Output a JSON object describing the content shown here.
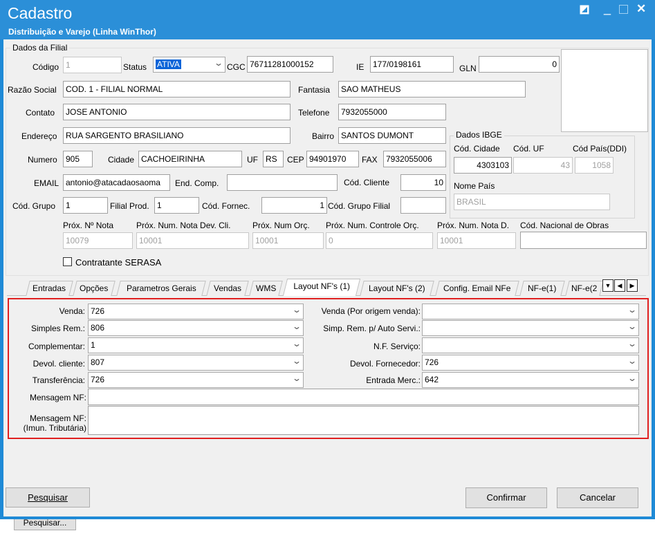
{
  "window": {
    "title": "Cadastro",
    "subtitle": "Distribuição e Varejo (Linha WinThor)",
    "bg_color": "#2b8fd8"
  },
  "icons": {
    "restore": "restore-icon",
    "minimize": "minimize-icon",
    "maximize": "maximize-icon",
    "close": "close-icon"
  },
  "filial": {
    "group_title": "Dados da Filial",
    "codigo": {
      "label": "Código",
      "value": "1"
    },
    "status": {
      "label": "Status",
      "value": "ATIVA"
    },
    "cgc": {
      "label": "CGC",
      "value": "76711281000152"
    },
    "ie": {
      "label": "IE",
      "value": "177/0198161"
    },
    "gln": {
      "label": "GLN",
      "value": "0"
    },
    "razao_social": {
      "label": "Razão Social",
      "value": "COD. 1 - FILIAL NORMAL"
    },
    "fantasia": {
      "label": "Fantasia",
      "value": "SAO MATHEUS"
    },
    "contato": {
      "label": "Contato",
      "value": "JOSE ANTONIO"
    },
    "telefone": {
      "label": "Telefone",
      "value": "7932055000"
    },
    "endereco": {
      "label": "Endereço",
      "value": "RUA SARGENTO BRASILIANO"
    },
    "bairro": {
      "label": "Bairro",
      "value": "SANTOS DUMONT"
    },
    "numero": {
      "label": "Numero",
      "value": "905"
    },
    "cidade": {
      "label": "Cidade",
      "value": "CACHOEIRINHA"
    },
    "uf": {
      "label": "UF",
      "value": "RS"
    },
    "cep": {
      "label": "CEP",
      "value": "94901970"
    },
    "fax": {
      "label": "FAX",
      "value": "7932055006"
    },
    "email": {
      "label": "EMAIL",
      "value": "antonio@atacadaosaoma"
    },
    "end_comp": {
      "label": "End. Comp.",
      "value": ""
    },
    "cod_cliente": {
      "label": "Cód. Cliente",
      "value": "10"
    },
    "cod_grupo": {
      "label": "Cód. Grupo",
      "value": "1"
    },
    "filial_prod": {
      "label": "Filial Prod.",
      "value": "1"
    },
    "cod_fornec": {
      "label": "Cód. Fornec.",
      "value": "1"
    },
    "cod_grupo_filial": {
      "label": "Cód. Grupo Filial",
      "value": ""
    },
    "prox_nota": {
      "label": "Próx. Nº Nota",
      "value": "10079"
    },
    "prox_nota_dev": {
      "label": "Próx. Num. Nota Dev. Cli.",
      "value": "10001"
    },
    "prox_orc": {
      "label": "Próx. Num Orç.",
      "value": "10001"
    },
    "prox_ctrl_orc": {
      "label": "Próx. Num. Controle Orç.",
      "value": "0"
    },
    "prox_nota_d": {
      "label": "Próx. Num. Nota D.",
      "value": "10001"
    },
    "cod_obras": {
      "label": "Cód. Nacional de Obras",
      "value": ""
    },
    "serasa": {
      "label": "Contratante SERASA",
      "checked": false
    }
  },
  "ibge": {
    "group_title": "Dados IBGE",
    "cod_cidade": {
      "label": "Cód. Cidade",
      "value": "4303103"
    },
    "cod_uf": {
      "label": "Cód. UF",
      "value": "43"
    },
    "cod_pais": {
      "label": "Cód País(DDI)",
      "value": "1058"
    },
    "nome_pais": {
      "label": "Nome País",
      "value": "BRASIL"
    }
  },
  "tabs": [
    {
      "label": "Entradas"
    },
    {
      "label": "Opções"
    },
    {
      "label": "Parametros Gerais"
    },
    {
      "label": "Vendas"
    },
    {
      "label": "WMS"
    },
    {
      "label": "Layout NF's (1)"
    },
    {
      "label": "Layout NF's (2)"
    },
    {
      "label": "Config. Email NFe"
    },
    {
      "label": "NF-e(1)"
    },
    {
      "label": "NF-e(2"
    }
  ],
  "layout": {
    "venda": {
      "label": "Venda:",
      "value": "726"
    },
    "simples_rem": {
      "label": "Simples Rem.:",
      "value": "806"
    },
    "complementar": {
      "label": "Complementar:",
      "value": "1"
    },
    "devol_cliente": {
      "label": "Devol. cliente:",
      "value": "807"
    },
    "transferencia": {
      "label": "Transferência:",
      "value": "726"
    },
    "venda_origem": {
      "label": "Venda (Por origem venda):",
      "value": ""
    },
    "simp_rem_auto": {
      "label": "Simp. Rem. p/ Auto Servi.:",
      "value": ""
    },
    "nf_servico": {
      "label": "N.F. Serviço:",
      "value": ""
    },
    "devol_fornecedor": {
      "label": "Devol. Fornecedor:",
      "value": "726"
    },
    "entrada_merc": {
      "label": "Entrada Merc.:",
      "value": "642"
    },
    "mensagem_nf": {
      "label": "Mensagem NF:",
      "value": ""
    },
    "mensagem_nf_imun_1": "Mensagem NF:",
    "mensagem_nf_imun_2": "(Imun. Tributária)",
    "highlight_color": "#e02020"
  },
  "buttons": {
    "pesquisar": "Pesquisar",
    "confirmar": "Confirmar",
    "cancelar": "Cancelar",
    "behind": "Pesquisar..."
  }
}
